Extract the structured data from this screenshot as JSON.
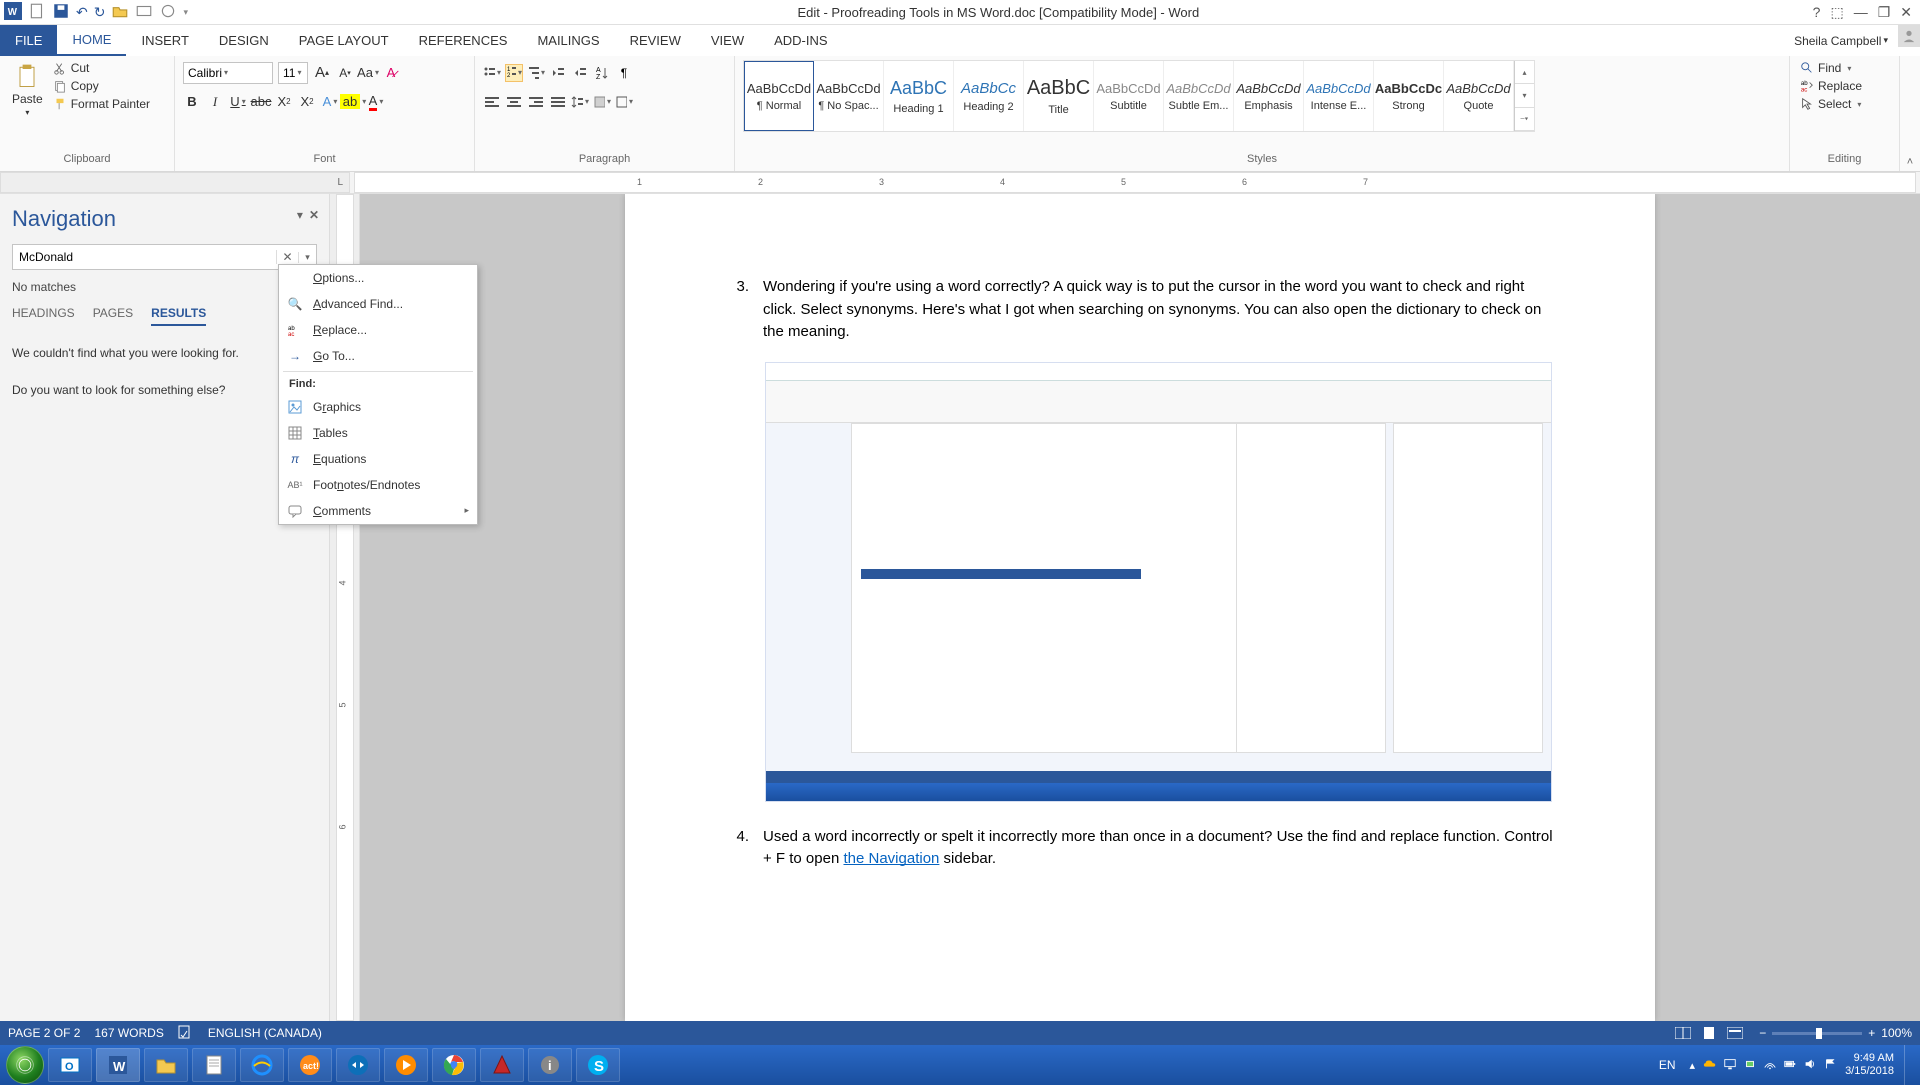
{
  "titlebar": {
    "title": "Edit - Proofreading Tools in MS Word.doc [Compatibility Mode] - Word",
    "help": "?"
  },
  "ribbon_tabs": {
    "file": "FILE",
    "home": "HOME",
    "insert": "INSERT",
    "design": "DESIGN",
    "page_layout": "PAGE LAYOUT",
    "references": "REFERENCES",
    "mailings": "MAILINGS",
    "review": "REVIEW",
    "view": "VIEW",
    "addins": "ADD-INS",
    "user_name": "Sheila Campbell"
  },
  "ribbon": {
    "clipboard": {
      "label": "Clipboard",
      "paste": "Paste",
      "cut": "Cut",
      "copy": "Copy",
      "format_painter": "Format Painter"
    },
    "font": {
      "label": "Font",
      "name": "Calibri",
      "size": "11"
    },
    "paragraph": {
      "label": "Paragraph"
    },
    "styles": {
      "label": "Styles",
      "items": [
        {
          "preview": "AaBbCcDd",
          "name": "¶ Normal"
        },
        {
          "preview": "AaBbCcDd",
          "name": "¶ No Spac..."
        },
        {
          "preview": "AaBbC",
          "name": "Heading 1"
        },
        {
          "preview": "AaBbCc",
          "name": "Heading 2"
        },
        {
          "preview": "AaBbC",
          "name": "Title"
        },
        {
          "preview": "AaBbCcDd",
          "name": "Subtitle"
        },
        {
          "preview": "AaBbCcDd",
          "name": "Subtle Em..."
        },
        {
          "preview": "AaBbCcDd",
          "name": "Emphasis"
        },
        {
          "preview": "AaBbCcDd",
          "name": "Intense E..."
        },
        {
          "preview": "AaBbCcDc",
          "name": "Strong"
        },
        {
          "preview": "AaBbCcDd",
          "name": "Quote"
        }
      ]
    },
    "editing": {
      "label": "Editing",
      "find": "Find",
      "replace": "Replace",
      "select": "Select"
    }
  },
  "nav": {
    "title": "Navigation",
    "search_value": "McDonald",
    "no_matches": "No matches",
    "tab_headings": "HEADINGS",
    "tab_pages": "PAGES",
    "tab_results": "RESULTS",
    "msg1": "We couldn't find what you were looking for.",
    "msg2": "Do you want to look for something else?"
  },
  "dropdown": {
    "options": "Options...",
    "advanced_find": "Advanced Find...",
    "replace": "Replace...",
    "goto": "Go To...",
    "find_label": "Find:",
    "graphics": "Graphics",
    "tables": "Tables",
    "equations": "Equations",
    "footnotes": "Footnotes/Endnotes",
    "comments": "Comments"
  },
  "doc": {
    "item3_num": "3.",
    "item3_text": "Wondering if you're using a word correctly?  A quick way is to put the cursor in the word you want to check and right click.  Select synonyms.  Here's what I got when searching on synonyms.  You can also open the dictionary to check on the meaning.",
    "item4_num": "4.",
    "item4_text_a": "Used a word incorrectly or spelt it incorrectly more than once in a document?  Use the find and replace function.  Control + F to open ",
    "item4_link": "the  Navigation",
    "item4_text_b": " sidebar."
  },
  "status": {
    "page": "PAGE 2 OF 2",
    "words": "167 WORDS",
    "lang": "ENGLISH (CANADA)",
    "zoom": "100%"
  },
  "taskbar": {
    "lang": "EN",
    "time": "9:49 AM",
    "date": "3/15/2018"
  }
}
